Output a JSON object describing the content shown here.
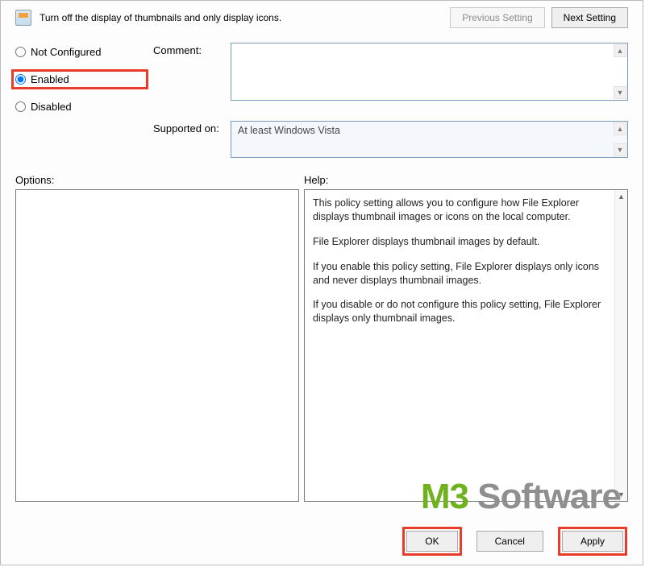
{
  "header": {
    "title": "Turn off the display of thumbnails and only display icons.",
    "prev_label": "Previous Setting",
    "next_label": "Next Setting"
  },
  "radios": {
    "not_configured": "Not Configured",
    "enabled": "Enabled",
    "disabled": "Disabled",
    "selected": "enabled"
  },
  "labels": {
    "comment": "Comment:",
    "supported": "Supported on:",
    "options": "Options:",
    "help": "Help:"
  },
  "supported_text": "At least Windows Vista",
  "help": {
    "p1": "This policy setting allows you to configure how File Explorer displays thumbnail images or icons on the local computer.",
    "p2": "File Explorer displays thumbnail images by default.",
    "p3": "If you enable this policy setting, File Explorer displays only icons and never displays thumbnail images.",
    "p4": "If you disable or do not configure this policy setting, File Explorer displays only thumbnail images."
  },
  "buttons": {
    "ok": "OK",
    "cancel": "Cancel",
    "apply": "Apply"
  },
  "watermark": {
    "m3": "M3",
    "soft": " Software"
  }
}
